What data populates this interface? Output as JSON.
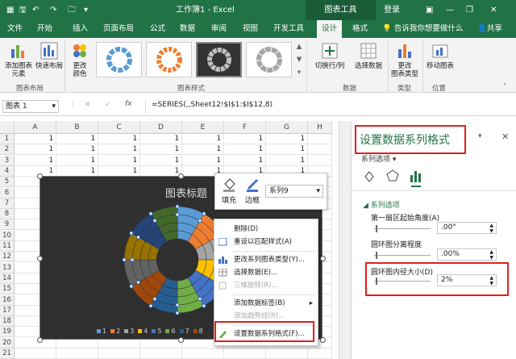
{
  "titlebar": {
    "title": "工作簿1 - Excel",
    "context_tab": "图表工具",
    "login": "登录"
  },
  "tabs": [
    "文件",
    "开始",
    "插入",
    "页面布局",
    "公式",
    "数据",
    "审阅",
    "视图",
    "开发工具",
    "设计",
    "格式"
  ],
  "tell_me": "告诉我你想要做什么",
  "share": "共享",
  "ribbon": {
    "add_element": "添加图表\n元素",
    "quick_layout": "快速布局",
    "change_colors": "更改\n颜色",
    "switch_row_col": "切换行/列",
    "select_data": "选择数据",
    "change_type": "更改\n图表类型",
    "move_chart": "移动图表",
    "groups": {
      "layout": "图表布局",
      "styles": "图表样式",
      "data": "数据",
      "type": "类型",
      "location": "位置"
    }
  },
  "formula_bar": {
    "name_box": "图表 1",
    "formula": "=SERIES(,,Sheet12!$I$1:$I$12,8)"
  },
  "columns": [
    "A",
    "B",
    "C",
    "D",
    "E",
    "F",
    "G",
    "H"
  ],
  "rows": [
    "1",
    "2",
    "3",
    "4",
    "5",
    "6",
    "7",
    "8",
    "9",
    "10",
    "11",
    "12",
    "13",
    "14",
    "15",
    "16",
    "17",
    "18",
    "19",
    "20",
    "21"
  ],
  "cell_value": "1",
  "chart": {
    "title": "图表标题",
    "legend": [
      "1",
      "2",
      "3",
      "4",
      "5",
      "6",
      "7",
      "8"
    ],
    "colors": [
      "#5b9bd5",
      "#ed7d31",
      "#a5a5a5",
      "#ffc000",
      "#4472c4",
      "#70ad47",
      "#255e91",
      "#9e480e",
      "#636363",
      "#997300",
      "#264478",
      "#43682b"
    ]
  },
  "mini_toolbar": {
    "fill": "填充",
    "outline": "边框",
    "series": "系列9"
  },
  "context_menu": [
    {
      "label": "删除(D)",
      "disabled": false
    },
    {
      "label": "重设以匹配样式(A)",
      "disabled": false
    },
    {
      "label": "更改系列图表类型(Y)...",
      "disabled": false
    },
    {
      "label": "选择数据(E)...",
      "disabled": false
    },
    {
      "label": "三维旋转(R)...",
      "disabled": true
    },
    {
      "label": "添加数据标签(B)",
      "disabled": false
    },
    {
      "label": "添加趋势线(R)...",
      "disabled": true
    },
    {
      "label": "设置数据系列格式(F)...",
      "disabled": false
    }
  ],
  "pane": {
    "title": "设置数据系列格式",
    "options_label": "系列选项",
    "section": "系列选项",
    "first_angle_label": "第一扇区起始角度(A)",
    "first_angle_value": ".00°",
    "explosion_label": "圆环图分离程度",
    "explosion_value": ".00%",
    "hole_label": "圆环图内径大小(D)",
    "hole_value": "2%"
  }
}
